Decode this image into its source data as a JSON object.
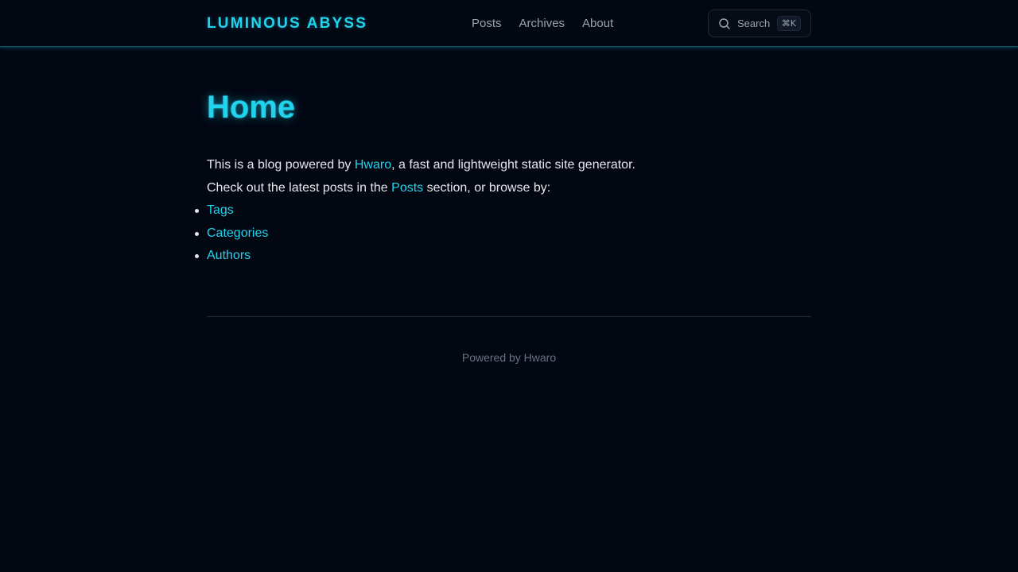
{
  "header": {
    "brand": "LUMINOUS ABYSS",
    "nav": [
      {
        "label": "Posts"
      },
      {
        "label": "Archives"
      },
      {
        "label": "About"
      }
    ],
    "search": {
      "label": "Search",
      "shortcut": "⌘K",
      "icon": "search-icon"
    }
  },
  "main": {
    "title": "Home",
    "intro_prefix": "This is a blog powered by ",
    "intro_link": "Hwaro",
    "intro_suffix": ", a fast and lightweight static site generator.",
    "browse_prefix": "Check out the latest posts in the ",
    "browse_link": "Posts",
    "browse_suffix": " section, or browse by:",
    "browse_items": [
      {
        "label": "Tags"
      },
      {
        "label": "Categories"
      },
      {
        "label": "Authors"
      }
    ]
  },
  "footer": {
    "text": "Powered by Hwaro"
  },
  "colors": {
    "background": "#030712",
    "accent": "#22d3ee",
    "text": "#e5e7eb",
    "muted": "#9ca3af"
  }
}
